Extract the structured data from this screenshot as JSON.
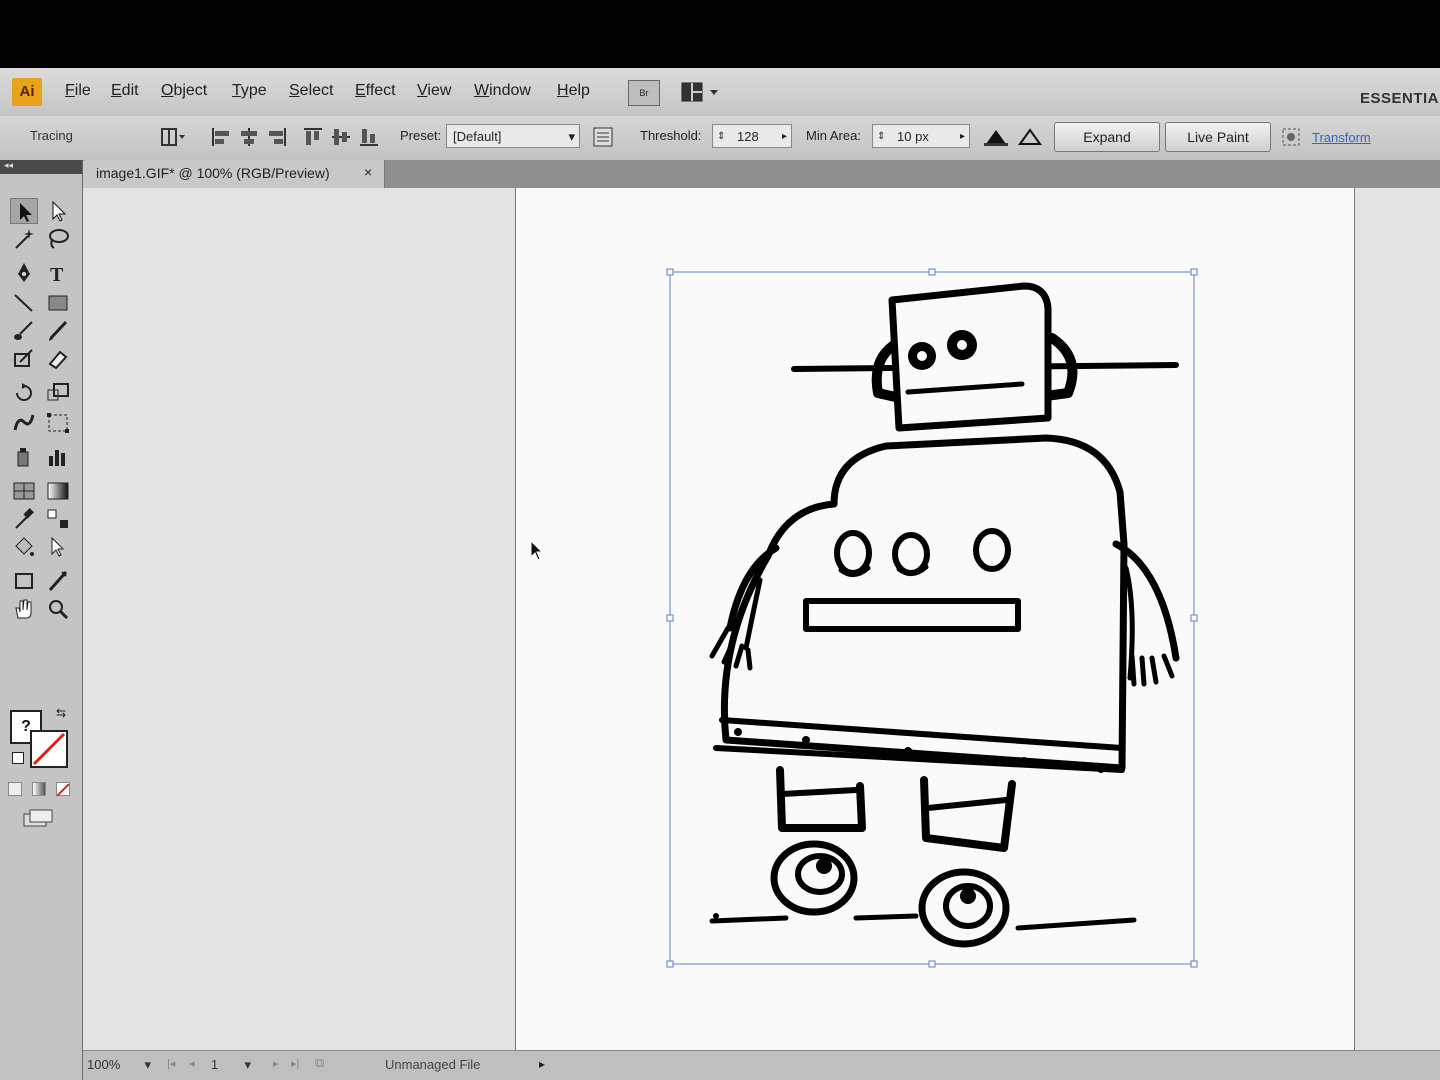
{
  "app": {
    "logo": "Ai",
    "workspace": "ESSENTIAL"
  },
  "menu": [
    "File",
    "Edit",
    "Object",
    "Type",
    "Select",
    "Effect",
    "View",
    "Window",
    "Help"
  ],
  "bridge_label": "Br",
  "control": {
    "mode_label": "Tracing",
    "preset_label": "Preset:",
    "preset_value": "[Default]",
    "threshold_label": "Threshold:",
    "threshold_value": "128",
    "min_area_label": "Min Area:",
    "min_area_value": "10 px",
    "expand_label": "Expand",
    "live_paint_label": "Live Paint",
    "transform_label": "Transform"
  },
  "document_tab": {
    "title": "image1.GIF* @ 100% (RGB/Preview)",
    "close": "×"
  },
  "tools": {
    "fill_placeholder": "?"
  },
  "status": {
    "zoom": "100%",
    "page": "1",
    "text": "Unmanaged File"
  },
  "colors": {
    "accent_link": "#3b62c8",
    "logo_bg": "#e8a31a",
    "bounding_box": "#5b82c8"
  }
}
